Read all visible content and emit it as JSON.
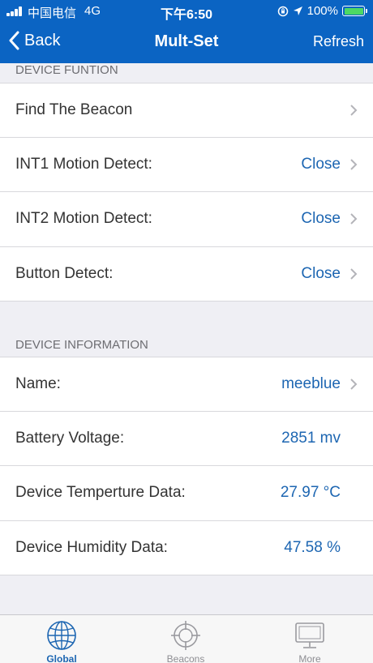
{
  "status": {
    "carrier": "中国电信",
    "network": "4G",
    "time": "下午6:50",
    "battery": "100%"
  },
  "nav": {
    "back_label": "Back",
    "title": "Mult-Set",
    "refresh_label": "Refresh"
  },
  "function_section": {
    "header": "DEVICE FUNTION",
    "rows": [
      {
        "label": "Find The Beacon",
        "value": ""
      },
      {
        "label": "INT1 Motion Detect:",
        "value": "Close"
      },
      {
        "label": "INT2 Motion Detect:",
        "value": "Close"
      },
      {
        "label": "Button Detect:",
        "value": "Close"
      }
    ]
  },
  "info_section": {
    "header": "DEVICE INFORMATION",
    "rows": [
      {
        "label": "Name:",
        "value": "meeblue"
      },
      {
        "label": "Battery Voltage:",
        "value": "2851 mv"
      },
      {
        "label": "Device Temperture Data:",
        "value": "27.97 °C"
      },
      {
        "label": "Device Humidity Data:",
        "value": "47.58 %"
      }
    ]
  },
  "tabs": [
    {
      "label": "Global",
      "icon": "globe-icon",
      "active": true
    },
    {
      "label": "Beacons",
      "icon": "crosshair-icon",
      "active": false
    },
    {
      "label": "More",
      "icon": "monitor-icon",
      "active": false
    }
  ],
  "colors": {
    "nav_bg": "#0b64c3",
    "value_text": "#1d66b2",
    "battery_fill": "#4cd964"
  }
}
